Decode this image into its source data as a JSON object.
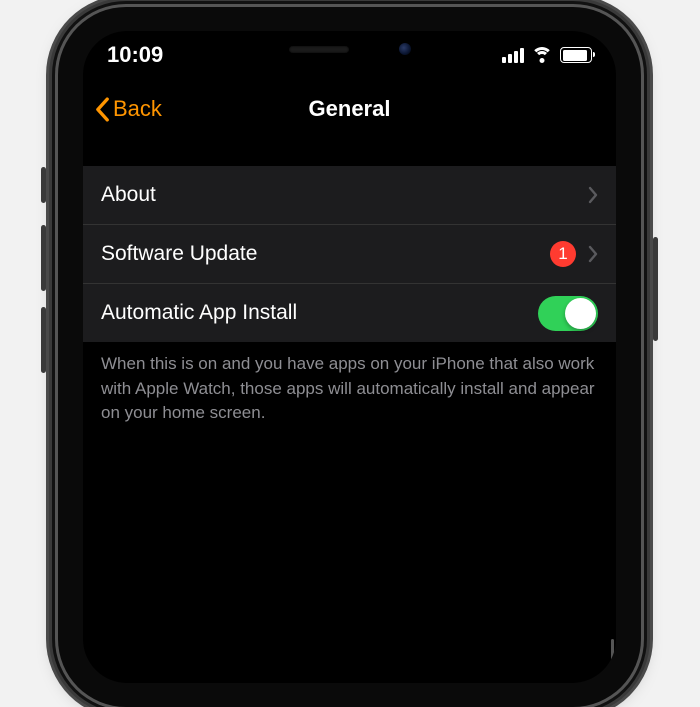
{
  "status": {
    "time": "10:09"
  },
  "nav": {
    "back_label": "Back",
    "title": "General"
  },
  "rows": {
    "about": {
      "label": "About"
    },
    "software_update": {
      "label": "Software Update",
      "badge": "1"
    },
    "auto_install": {
      "label": "Automatic App Install"
    }
  },
  "footer": {
    "text": "When this is on and you have apps on your iPhone that also work with Apple Watch, those apps will automatically install and appear on your home screen."
  }
}
